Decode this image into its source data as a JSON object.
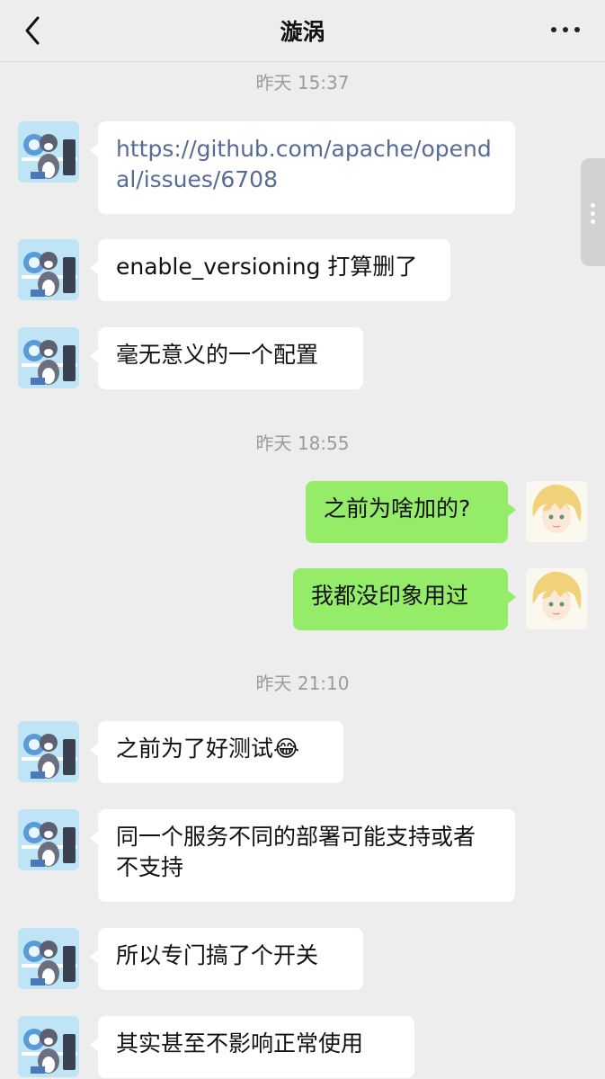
{
  "header": {
    "title": "漩涡",
    "back_icon": "chevron-left-icon",
    "more_icon": "more-horizontal-icon"
  },
  "timestamps": [
    "昨天 15:37",
    "昨天 18:55",
    "昨天 21:10"
  ],
  "messages": [
    {
      "side": "in",
      "text": "https://github.com/apache/opendal/issues/6708",
      "is_link": true
    },
    {
      "side": "in",
      "text": "enable_versioning 打算删了"
    },
    {
      "side": "in",
      "text": "毫无意义的一个配置"
    },
    {
      "side": "out",
      "text": "之前为啥加的?"
    },
    {
      "side": "out",
      "text": "我都没印象用过"
    },
    {
      "side": "in",
      "text": "之前为了好测试😂"
    },
    {
      "side": "in",
      "text": "同一个服务不同的部署可能支持或者不支持"
    },
    {
      "side": "in",
      "text": "所以专门搞了个开关"
    },
    {
      "side": "in",
      "text": "其实甚至不影响正常使用"
    }
  ],
  "colors": {
    "background": "#ededed",
    "incoming_bubble": "#ffffff",
    "outgoing_bubble": "#95ec69",
    "link": "#576b95",
    "timestamp": "#9b9b9b"
  }
}
